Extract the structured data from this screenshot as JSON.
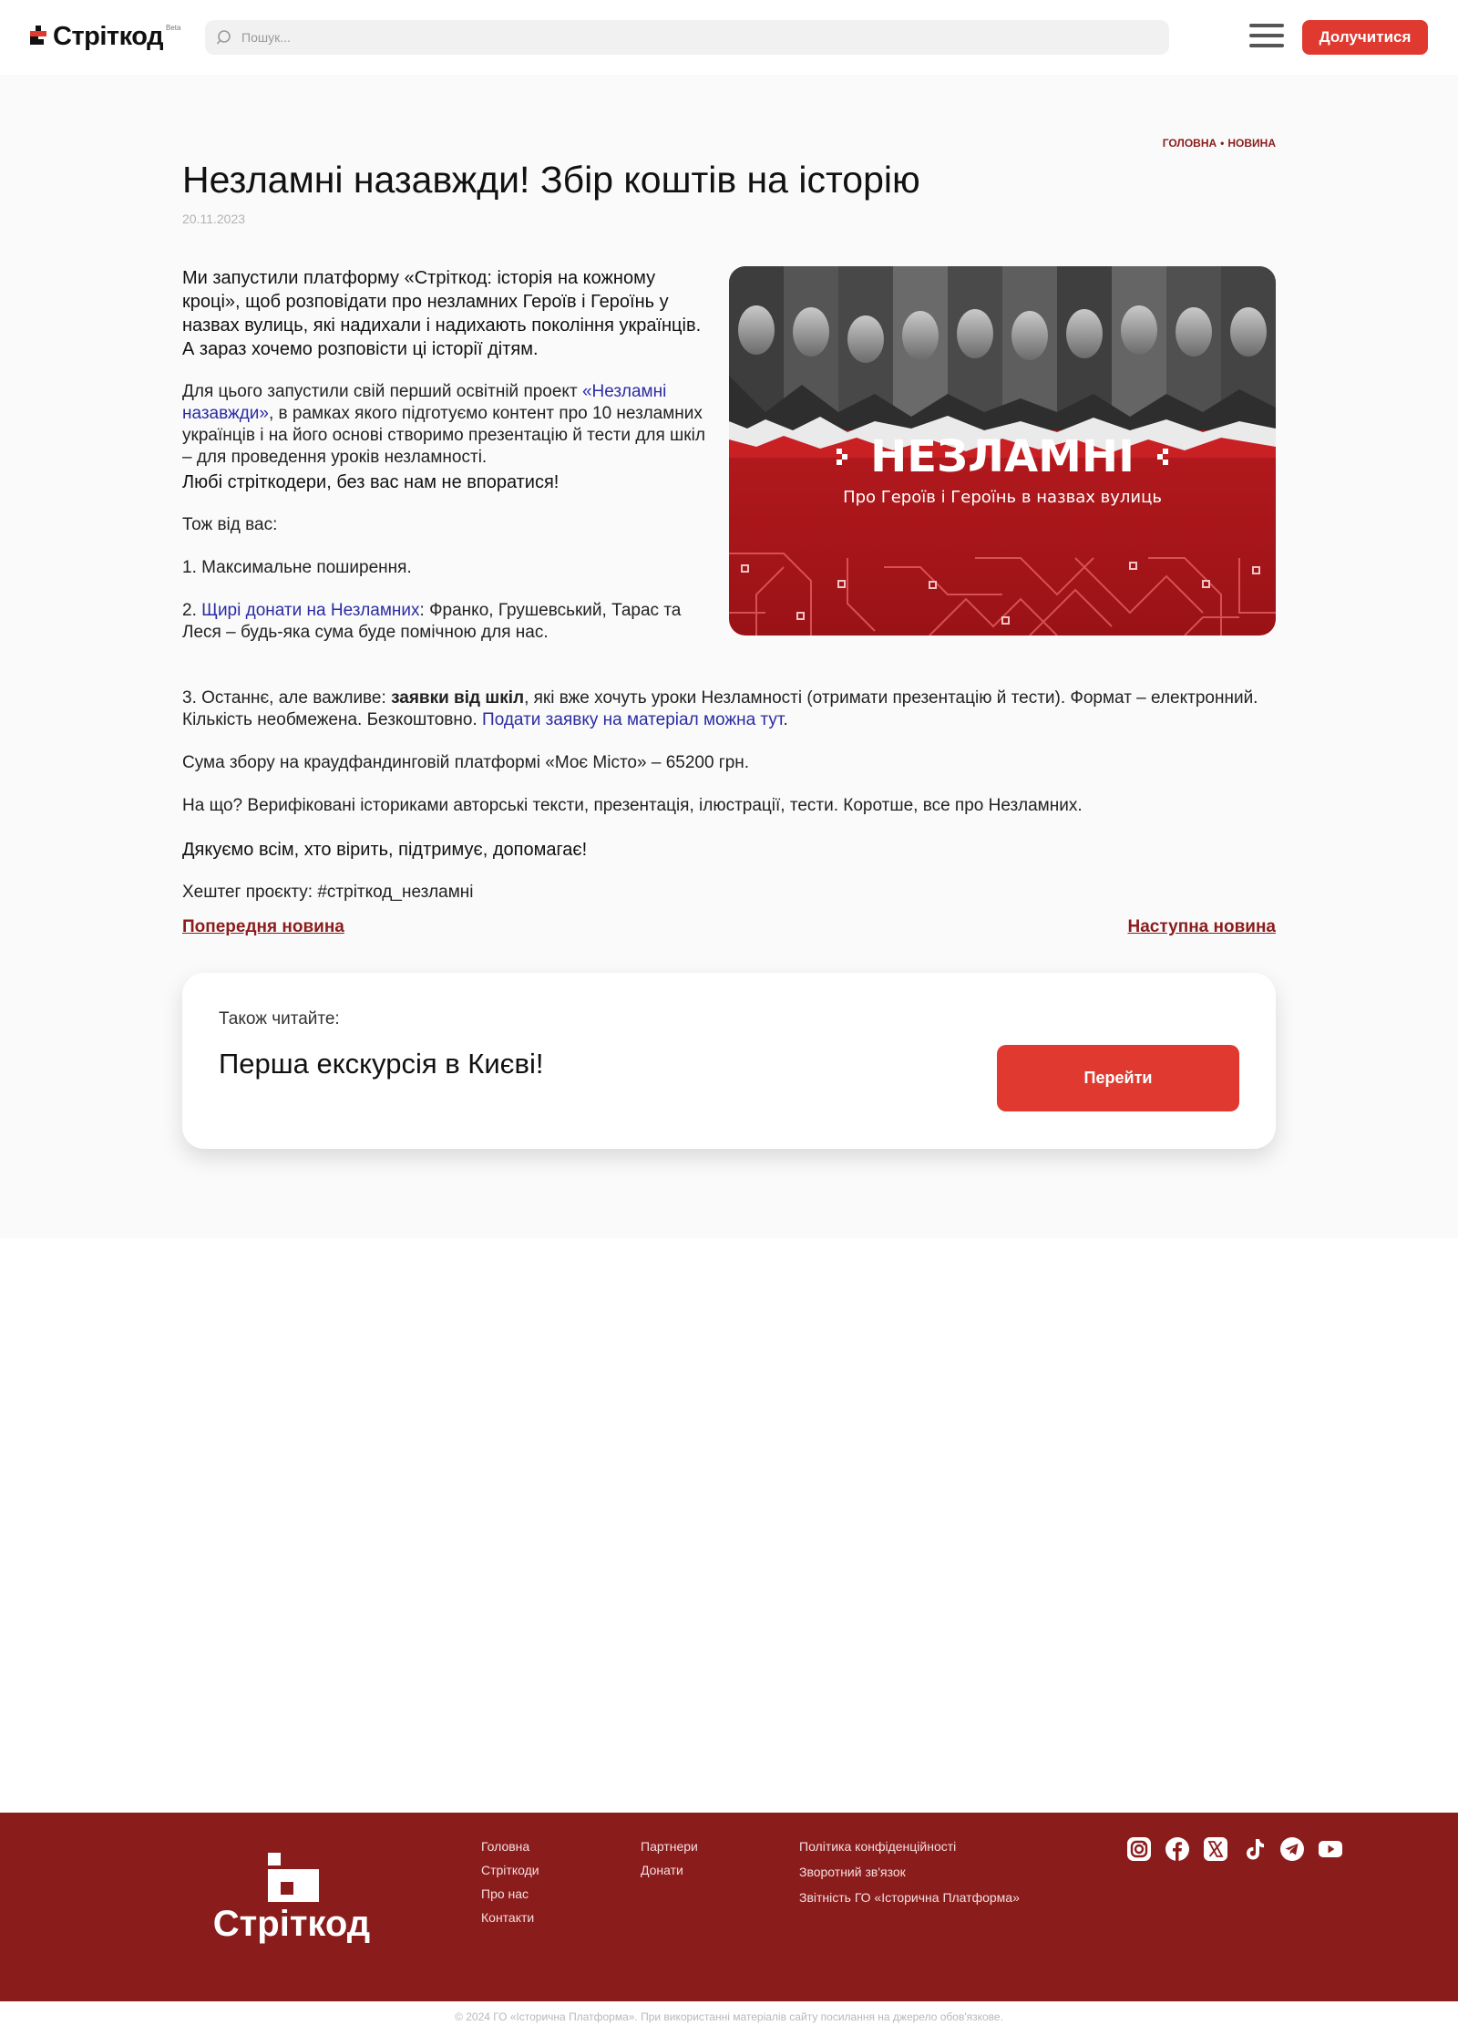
{
  "header": {
    "logo_text": "Стріткод",
    "logo_beta": "Beta",
    "search_placeholder": "Пошук...",
    "join_label": "Долучитися"
  },
  "breadcrumb": {
    "home": "ГОЛОВНА",
    "separator": "•",
    "current": "НОВИНА"
  },
  "article": {
    "title": "Незламні назавжди! Збір коштів на історію",
    "date": "20.11.2023",
    "lead": "Ми запустили платформу «Стріткод: історія на кожному кроці», щоб розповідати про незламних Героїв і Героїнь у назвах вулиць, які надихали і надихають покоління українців. А зараз хочемо розповісти ці історії дітям.",
    "p2_before": "Для цього запустили свій перший освітній проект ",
    "p2_link": "«Незламні назавжди»",
    "p2_after": ", в рамках якого підготуємо контент про 10 незламних українців і на його основі створимо презентацію й тести для шкіл – для проведення уроків незламності.",
    "p3": "Любі стріткодери, без вас нам не впоратися!",
    "p4": "Тож від вас:",
    "p5": "1. Максимальне поширення.",
    "p6_before": "2. ",
    "p6_link": "Щирі донати на Незламних",
    "p6_after": ": Франко, Грушевський, Тарас та Леся – будь-яка сума буде помічною для нас.",
    "p7_before": "3. Останнє, але важливе: ",
    "p7_bold": "заявки від шкіл",
    "p7_mid": ", які вже хочуть уроки Незламності (отримати презентацію й тести). Формат – електронний. Кількість необмежена. Безкоштовно. ",
    "p7_link": "Подати заявку на матеріал можна тут",
    "p7_end": ".",
    "p8": "Сума збору на краудфандинговій платформі «Моє Місто» – 65200 грн.",
    "p9": "На що? Верифіковані істориками авторські тексти, презентація, ілюстрації, тести. Коротше, все про Незламних.",
    "p10": "Дякуємо всім, хто вірить, підтримує, допомагає!",
    "p11": "Хештег проєкту: #стріткод_незламні",
    "image": {
      "title": "НЕЗЛАМНІ",
      "subtitle": "Про Героїв і Героїнь в назвах вулиць",
      "bg_color": "#b3191c"
    }
  },
  "navigation": {
    "prev": "Попередня новина",
    "next": "Наступна новина"
  },
  "also_read": {
    "label": "Також читайте:",
    "title": "Перша екскурсія в Києві!",
    "button": "Перейти"
  },
  "footer": {
    "logo_text": "Стріткод",
    "col1": [
      "Головна",
      "Стріткоди",
      "Про нас",
      "Контакти"
    ],
    "col2": [
      "Партнери",
      "Донати"
    ],
    "col3": [
      "Політика конфіденційності",
      "Зворотний зв'язок",
      "Звітність ГО «Історична Платформа»"
    ],
    "socials": [
      "instagram-icon",
      "facebook-icon",
      "x-icon",
      "tiktok-icon",
      "telegram-icon",
      "youtube-icon"
    ],
    "copyright": "© 2024 ГО «Історична Платформа». При використанні матеріалів сайту посилання на джерело обов'язкове."
  },
  "colors": {
    "accent": "#e03a30",
    "brand_dark": "#8b1c1c",
    "link": "#2b2ca3"
  }
}
